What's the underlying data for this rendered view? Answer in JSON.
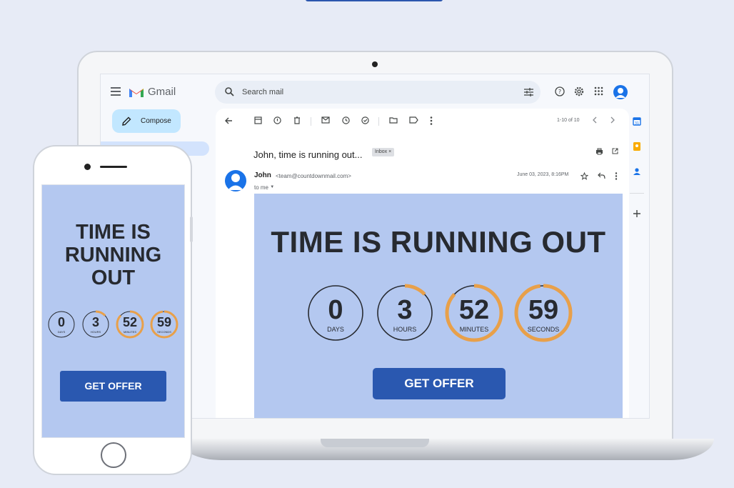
{
  "gmail": {
    "app_name": "Gmail",
    "search_placeholder": "Search mail",
    "compose_label": "Compose",
    "pager": "1-10 of 10",
    "subject": "John, time is running out...",
    "inbox_tag": "Inbox ×",
    "sender_name": "John",
    "sender_email": "<team@countdownmail.com>",
    "to_me": "to me",
    "date": "June 03, 2023, 8:16PM"
  },
  "email": {
    "title": "TIME IS RUNNING OUT",
    "button_label": "GET OFFER",
    "countdown": [
      {
        "value": "0",
        "label": "DAYS",
        "progress": 0.0
      },
      {
        "value": "3",
        "label": "HOURS",
        "progress": 0.13
      },
      {
        "value": "52",
        "label": "MINUTES",
        "progress": 0.87
      },
      {
        "value": "59",
        "label": "SECONDS",
        "progress": 0.98
      }
    ]
  },
  "mobile": {
    "title_line1": "TIME IS",
    "title_line2": "RUNNING",
    "title_line3": "OUT",
    "button_label": "GET OFFER"
  },
  "colors": {
    "accent_ring": "#e8a04a",
    "email_bg": "#b4c8f0",
    "button": "#2a58b0"
  }
}
